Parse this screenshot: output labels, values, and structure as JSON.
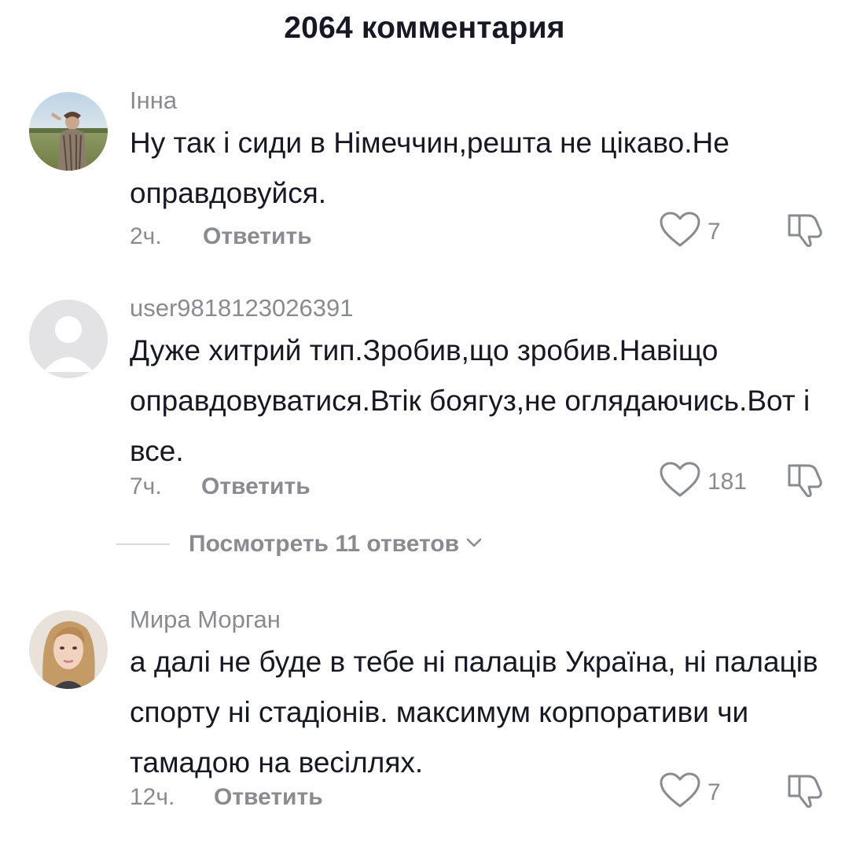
{
  "header": {
    "title": "2064 комментария"
  },
  "comments": [
    {
      "username": "Інна",
      "text": "Ну так і сиди в Німеччин,решта не цікаво.Не оправдовуйся.",
      "time": "2ч.",
      "reply_label": "Ответить",
      "likes": "7"
    },
    {
      "username": "user9818123026391",
      "text": "Дуже хитрий тип.Зробив,що зробив.Навіщо оправдовуватися.Втік боягуз,не оглядаючись.Вот і все.",
      "time": "7ч.",
      "reply_label": "Ответить",
      "likes": "181"
    },
    {
      "username": "Мира Морган",
      "text": "а далі не буде в тебе ні палаців Україна, ні палаців спорту ні стадіонів. максимум корпоративи чи тамадою на весіллях.",
      "time": "12ч.",
      "reply_label": "Ответить",
      "likes": "7"
    }
  ],
  "view_replies": {
    "label": "Посмотреть 11 ответов"
  },
  "icons": {
    "like": "heart-outline-icon",
    "dislike": "thumbs-down-icon",
    "chevron": "chevron-down-icon"
  },
  "colors": {
    "text": "#161823",
    "secondary": "#8a8b91",
    "divider": "#d7d8da"
  }
}
